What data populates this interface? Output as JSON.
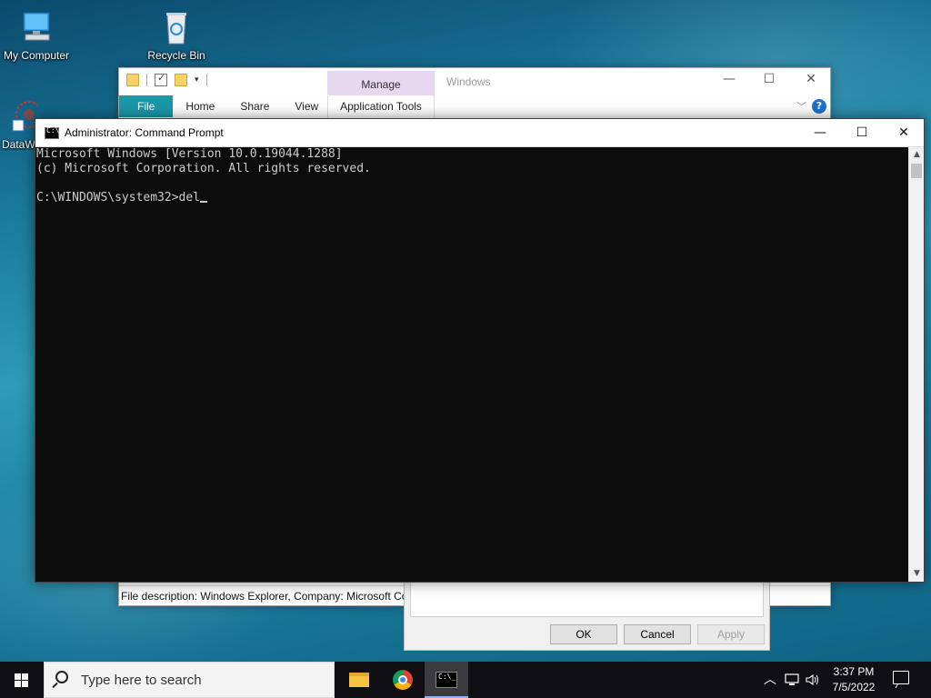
{
  "desktop": {
    "icons": [
      {
        "label": "My Computer"
      },
      {
        "label": "Recycle Bin"
      },
      {
        "label": "DataW"
      }
    ]
  },
  "explorer": {
    "title": "Windows",
    "context_tab": "Manage",
    "context_group": "Application Tools",
    "tabs": [
      "File",
      "Home",
      "Share",
      "View"
    ],
    "status": "File description: Windows Explorer, Company: Microsoft Co"
  },
  "properties_dialog": {
    "ok": "OK",
    "cancel": "Cancel",
    "apply": "Apply"
  },
  "cmd": {
    "title": "Administrator: Command Prompt",
    "lines": [
      "Microsoft Windows [Version 10.0.19044.1288]",
      "(c) Microsoft Corporation. All rights reserved.",
      "",
      "C:\\WINDOWS\\system32>del"
    ]
  },
  "window_controls": {
    "minimize": "—",
    "maximize": "☐",
    "close": "✕"
  },
  "taskbar": {
    "search_placeholder": "Type here to search",
    "apps": [
      "file-explorer-icon",
      "chrome-icon",
      "command-prompt-icon"
    ],
    "time": "3:37 PM",
    "date": "7/5/2022"
  }
}
